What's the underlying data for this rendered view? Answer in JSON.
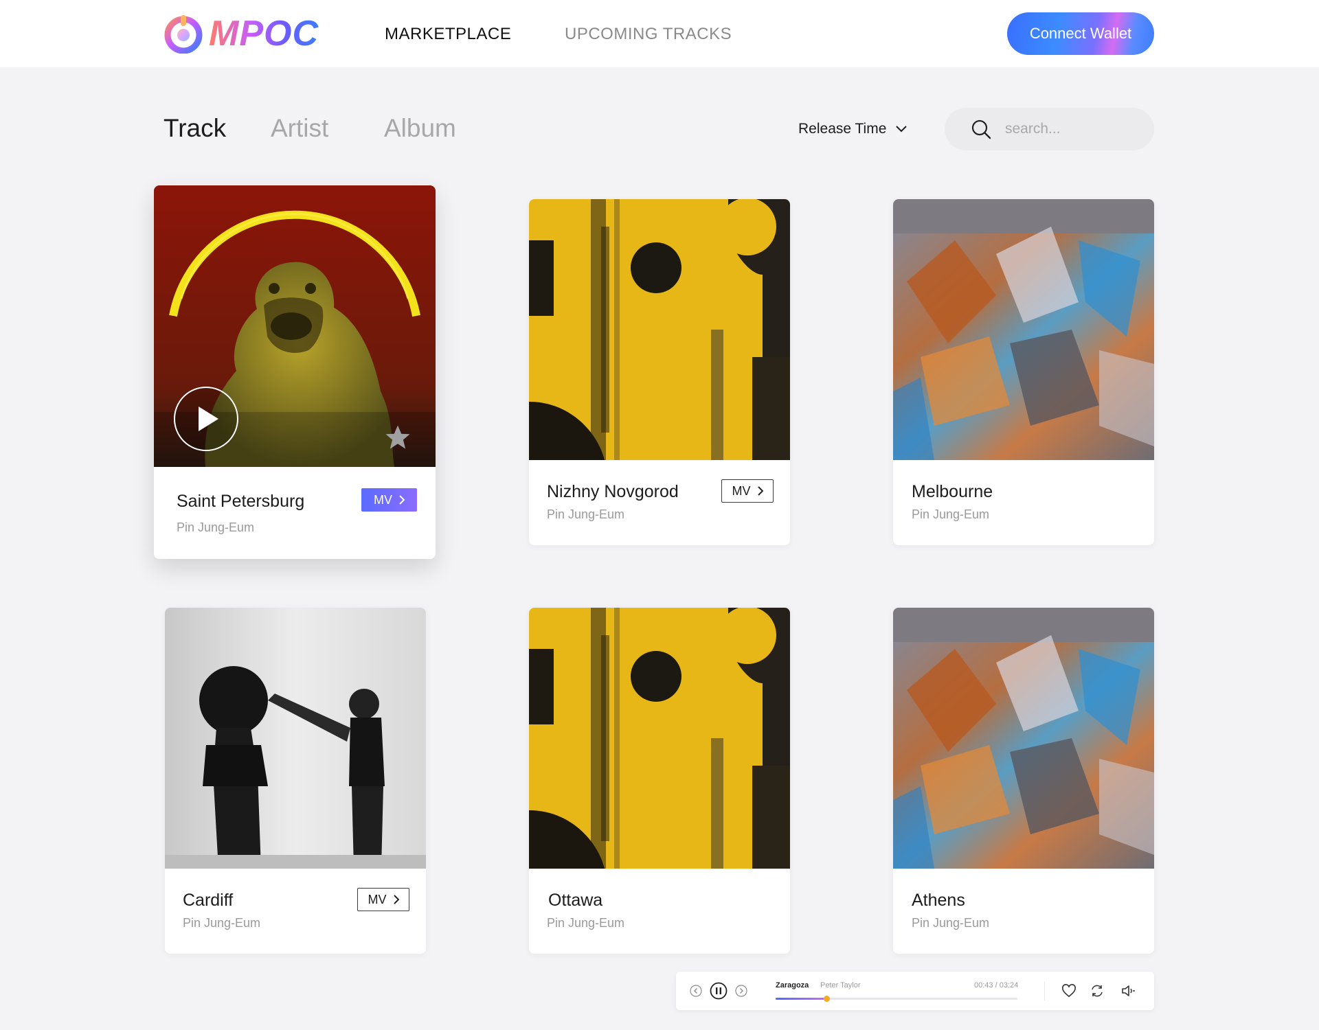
{
  "header": {
    "logo_text": "MPOC",
    "nav": [
      "MARKETPLACE",
      "UPCOMING TRACKS"
    ],
    "connect_label": "Connect Wallet"
  },
  "toolbar": {
    "tabs": [
      "Track",
      "Artist",
      "Album"
    ],
    "sort_label": "Release Time",
    "search_placeholder": "search..."
  },
  "cards": [
    {
      "title": "Saint Petersburg",
      "artist": "Pin Jung-Eum",
      "mv": "MV"
    },
    {
      "title": "Nizhny Novgorod",
      "artist": "Pin Jung-Eum",
      "mv": "MV"
    },
    {
      "title": "Melbourne",
      "artist": "Pin Jung-Eum"
    },
    {
      "title": "Cardiff",
      "artist": "Pin Jung-Eum",
      "mv": "MV"
    },
    {
      "title": "Ottawa",
      "artist": "Pin Jung-Eum"
    },
    {
      "title": "Athens",
      "artist": "Pin Jung-Eum"
    }
  ],
  "player": {
    "track": "Zaragoza",
    "artist": "Peter Taylor",
    "time": "00:43 / 03:24",
    "progress": 0.21
  }
}
